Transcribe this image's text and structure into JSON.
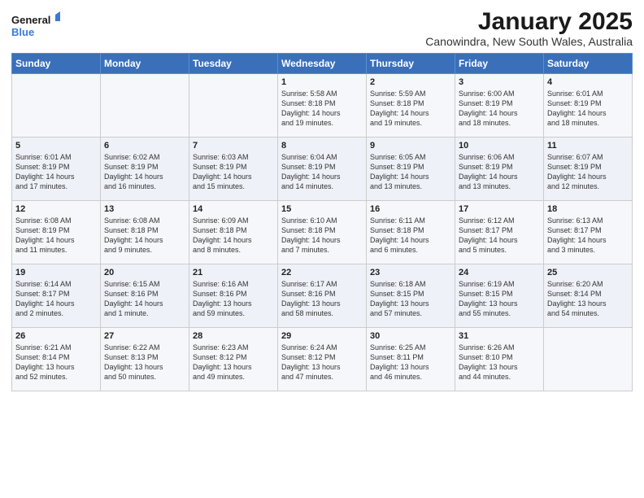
{
  "logo": {
    "line1": "General",
    "line2": "Blue"
  },
  "title": "January 2025",
  "subtitle": "Canowindra, New South Wales, Australia",
  "weekdays": [
    "Sunday",
    "Monday",
    "Tuesday",
    "Wednesday",
    "Thursday",
    "Friday",
    "Saturday"
  ],
  "weeks": [
    [
      {
        "day": "",
        "info": ""
      },
      {
        "day": "",
        "info": ""
      },
      {
        "day": "",
        "info": ""
      },
      {
        "day": "1",
        "info": "Sunrise: 5:58 AM\nSunset: 8:18 PM\nDaylight: 14 hours\nand 19 minutes."
      },
      {
        "day": "2",
        "info": "Sunrise: 5:59 AM\nSunset: 8:18 PM\nDaylight: 14 hours\nand 19 minutes."
      },
      {
        "day": "3",
        "info": "Sunrise: 6:00 AM\nSunset: 8:19 PM\nDaylight: 14 hours\nand 18 minutes."
      },
      {
        "day": "4",
        "info": "Sunrise: 6:01 AM\nSunset: 8:19 PM\nDaylight: 14 hours\nand 18 minutes."
      }
    ],
    [
      {
        "day": "5",
        "info": "Sunrise: 6:01 AM\nSunset: 8:19 PM\nDaylight: 14 hours\nand 17 minutes."
      },
      {
        "day": "6",
        "info": "Sunrise: 6:02 AM\nSunset: 8:19 PM\nDaylight: 14 hours\nand 16 minutes."
      },
      {
        "day": "7",
        "info": "Sunrise: 6:03 AM\nSunset: 8:19 PM\nDaylight: 14 hours\nand 15 minutes."
      },
      {
        "day": "8",
        "info": "Sunrise: 6:04 AM\nSunset: 8:19 PM\nDaylight: 14 hours\nand 14 minutes."
      },
      {
        "day": "9",
        "info": "Sunrise: 6:05 AM\nSunset: 8:19 PM\nDaylight: 14 hours\nand 13 minutes."
      },
      {
        "day": "10",
        "info": "Sunrise: 6:06 AM\nSunset: 8:19 PM\nDaylight: 14 hours\nand 13 minutes."
      },
      {
        "day": "11",
        "info": "Sunrise: 6:07 AM\nSunset: 8:19 PM\nDaylight: 14 hours\nand 12 minutes."
      }
    ],
    [
      {
        "day": "12",
        "info": "Sunrise: 6:08 AM\nSunset: 8:19 PM\nDaylight: 14 hours\nand 11 minutes."
      },
      {
        "day": "13",
        "info": "Sunrise: 6:08 AM\nSunset: 8:18 PM\nDaylight: 14 hours\nand 9 minutes."
      },
      {
        "day": "14",
        "info": "Sunrise: 6:09 AM\nSunset: 8:18 PM\nDaylight: 14 hours\nand 8 minutes."
      },
      {
        "day": "15",
        "info": "Sunrise: 6:10 AM\nSunset: 8:18 PM\nDaylight: 14 hours\nand 7 minutes."
      },
      {
        "day": "16",
        "info": "Sunrise: 6:11 AM\nSunset: 8:18 PM\nDaylight: 14 hours\nand 6 minutes."
      },
      {
        "day": "17",
        "info": "Sunrise: 6:12 AM\nSunset: 8:17 PM\nDaylight: 14 hours\nand 5 minutes."
      },
      {
        "day": "18",
        "info": "Sunrise: 6:13 AM\nSunset: 8:17 PM\nDaylight: 14 hours\nand 3 minutes."
      }
    ],
    [
      {
        "day": "19",
        "info": "Sunrise: 6:14 AM\nSunset: 8:17 PM\nDaylight: 14 hours\nand 2 minutes."
      },
      {
        "day": "20",
        "info": "Sunrise: 6:15 AM\nSunset: 8:16 PM\nDaylight: 14 hours\nand 1 minute."
      },
      {
        "day": "21",
        "info": "Sunrise: 6:16 AM\nSunset: 8:16 PM\nDaylight: 13 hours\nand 59 minutes."
      },
      {
        "day": "22",
        "info": "Sunrise: 6:17 AM\nSunset: 8:16 PM\nDaylight: 13 hours\nand 58 minutes."
      },
      {
        "day": "23",
        "info": "Sunrise: 6:18 AM\nSunset: 8:15 PM\nDaylight: 13 hours\nand 57 minutes."
      },
      {
        "day": "24",
        "info": "Sunrise: 6:19 AM\nSunset: 8:15 PM\nDaylight: 13 hours\nand 55 minutes."
      },
      {
        "day": "25",
        "info": "Sunrise: 6:20 AM\nSunset: 8:14 PM\nDaylight: 13 hours\nand 54 minutes."
      }
    ],
    [
      {
        "day": "26",
        "info": "Sunrise: 6:21 AM\nSunset: 8:14 PM\nDaylight: 13 hours\nand 52 minutes."
      },
      {
        "day": "27",
        "info": "Sunrise: 6:22 AM\nSunset: 8:13 PM\nDaylight: 13 hours\nand 50 minutes."
      },
      {
        "day": "28",
        "info": "Sunrise: 6:23 AM\nSunset: 8:12 PM\nDaylight: 13 hours\nand 49 minutes."
      },
      {
        "day": "29",
        "info": "Sunrise: 6:24 AM\nSunset: 8:12 PM\nDaylight: 13 hours\nand 47 minutes."
      },
      {
        "day": "30",
        "info": "Sunrise: 6:25 AM\nSunset: 8:11 PM\nDaylight: 13 hours\nand 46 minutes."
      },
      {
        "day": "31",
        "info": "Sunrise: 6:26 AM\nSunset: 8:10 PM\nDaylight: 13 hours\nand 44 minutes."
      },
      {
        "day": "",
        "info": ""
      }
    ]
  ]
}
